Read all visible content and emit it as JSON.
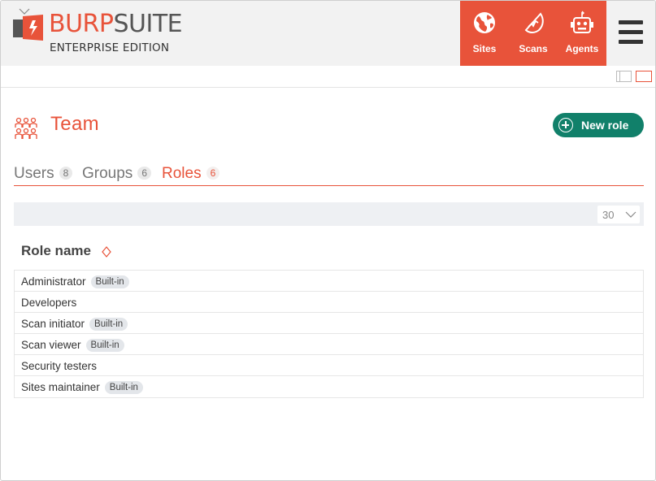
{
  "brand": {
    "name_part1": "BURP",
    "name_part2": "SUITE",
    "edition": "ENTERPRISE EDITION",
    "accent_color": "#e8533a",
    "primary_button_color": "#11806a"
  },
  "nav": {
    "items": [
      {
        "label": "Sites",
        "icon": "globe-icon"
      },
      {
        "label": "Scans",
        "icon": "radar-icon"
      },
      {
        "label": "Agents",
        "icon": "robot-icon"
      }
    ],
    "menu_icon": "hamburger-icon"
  },
  "page": {
    "title": "Team",
    "title_icon": "team-icon",
    "new_role_label": "New role"
  },
  "tabs": [
    {
      "label": "Users",
      "count": "8",
      "active": false
    },
    {
      "label": "Groups",
      "count": "6",
      "active": false
    },
    {
      "label": "Roles",
      "count": "6",
      "active": true
    }
  ],
  "pagination": {
    "per_page": "30"
  },
  "table": {
    "column_header": "Role name",
    "rows": [
      {
        "name": "Administrator",
        "badge": "Built-in"
      },
      {
        "name": "Developers",
        "badge": ""
      },
      {
        "name": "Scan initiator",
        "badge": "Built-in"
      },
      {
        "name": "Scan viewer",
        "badge": "Built-in"
      },
      {
        "name": "Security testers",
        "badge": ""
      },
      {
        "name": "Sites maintainer",
        "badge": "Built-in"
      }
    ]
  }
}
